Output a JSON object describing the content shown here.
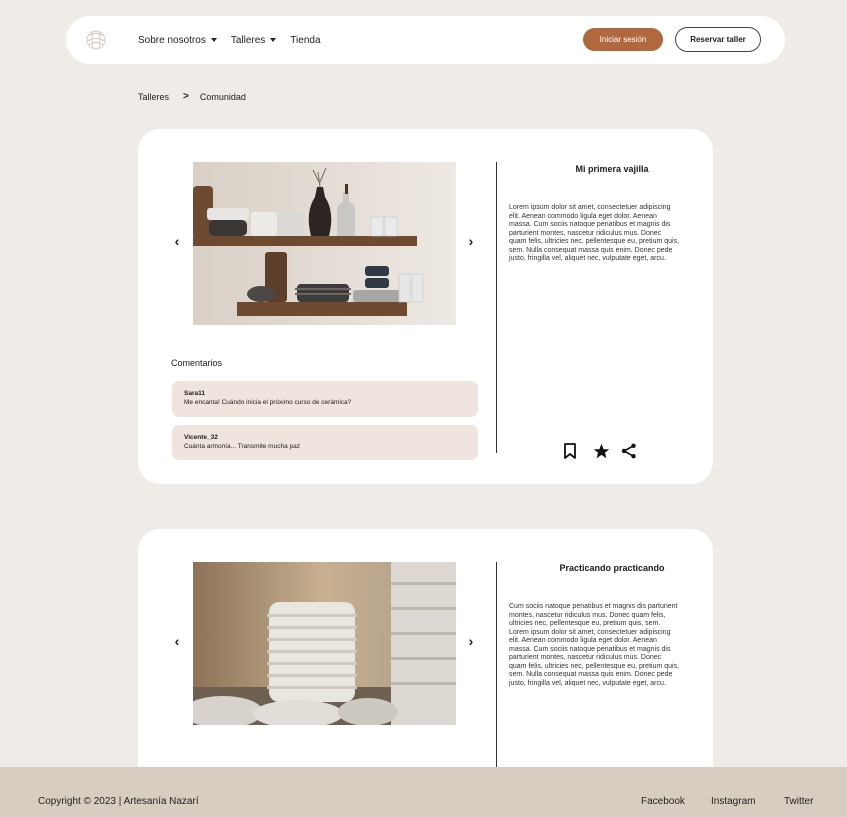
{
  "header": {
    "nav": [
      {
        "label": "Sobre nosotros",
        "has_dropdown": true
      },
      {
        "label": "Talleres",
        "has_dropdown": true
      },
      {
        "label": "Tienda",
        "has_dropdown": false
      }
    ],
    "login_label": "Iniciar sesión",
    "book_label": "Reservar taller",
    "accent_color": "#b0683e"
  },
  "breadcrumb": {
    "parent": "Talleres",
    "current": "Comunidad"
  },
  "posts": [
    {
      "title": "Mi primera vajilla",
      "body": "Lorem ipsum dolor sit amet, consectetuer adipiscing elit. Aenean commodo ligula eget dolor. Aenean massa. Cum sociis natoque penatibus et magnis dis parturient montes, nascetur ridiculus mus. Donec quam felis, ultricies nec, pellentesque eu, pretium quis, sem. Nulla consequat massa quis enim. Donec pede justo, fringilla vel, aliquet nec, vulputate eget, arcu.",
      "prev_label": "‹",
      "next_label": "›",
      "comments_title": "Comentarios",
      "comments": [
        {
          "user": "Sara11",
          "text": "Me encanta! Cuándo inicia el próximo curso de cerámica?"
        },
        {
          "user": "Vicente_32",
          "text": "Cuánta armonía... Transmite mucha paz"
        }
      ],
      "icons": [
        "bookmark-icon",
        "star-icon",
        "share-icon"
      ]
    },
    {
      "title": "Practicando practicando",
      "body": "Cum sociis natoque penatibus et magnis dis parturient montes, nascetur ridiculus mus. Donec quam felis, ultricies nec, pellentesque eu, pretium quis, sem. Lorem ipsum dolor sit amet, consectetuer adipiscing elit. Aenean commodo ligula eget dolor. Aenean massa. Cum sociis natoque penatibus et magnis dis parturient montes, nascetur ridiculus mus. Donec quam felis, ultricies nec, pellentesque eu, pretium quis, sem. Nulla consequat massa quis enim. Donec pede justo, fringilla vel, aliquet nec, vulputate eget, arcu.",
      "prev_label": "‹",
      "next_label": "›"
    }
  ],
  "footer": {
    "copyright": "Copyright © 2023 | Artesanía Nazarí",
    "social": [
      "Facebook",
      "Instagram",
      "Twitter"
    ]
  }
}
